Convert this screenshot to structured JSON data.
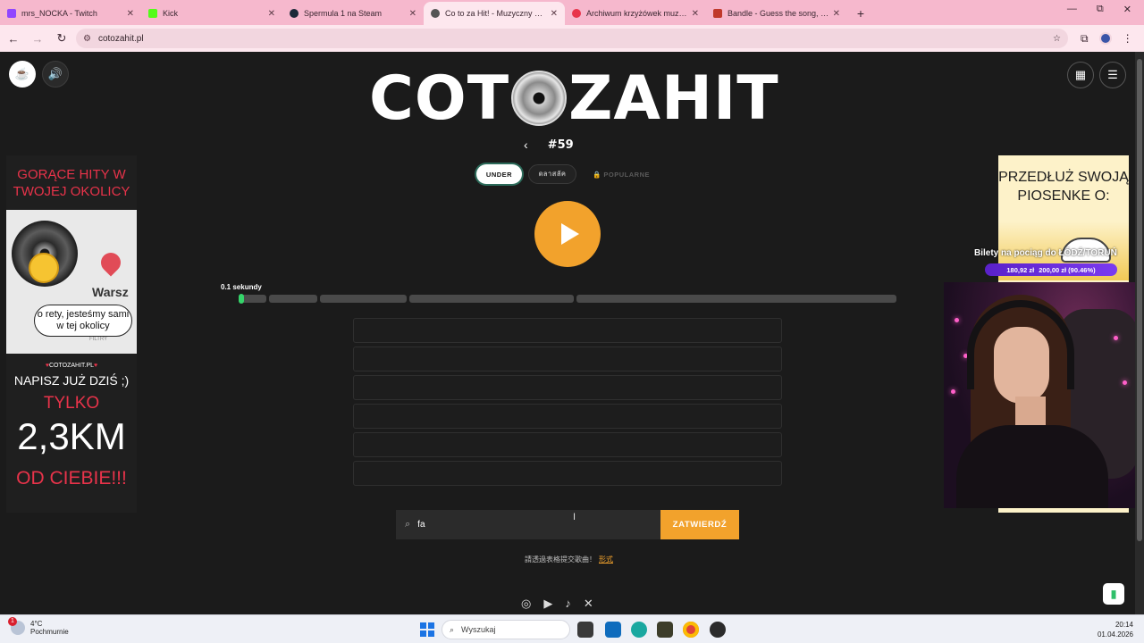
{
  "browser": {
    "tabs": [
      {
        "title": "mrs_NOCKA - Twitch",
        "color": "#9146ff",
        "active": false
      },
      {
        "title": "Kick",
        "color": "#53fc18",
        "active": false
      },
      {
        "title": "Spermula 1 na Steam",
        "color": "#1b2838",
        "active": false
      },
      {
        "title": "Co to za Hit! - Muzyczny Quiz H",
        "color": "#555555",
        "active": true
      },
      {
        "title": "Archiwum krzyżówek muzyczny",
        "color": "#e8334a",
        "active": false
      },
      {
        "title": "Bandle - Guess the song, one in",
        "color": "#c0392b",
        "active": false
      }
    ],
    "tab_close": "✕",
    "new_tab": "+",
    "window_controls": {
      "minimize": "—",
      "restore": "⧉",
      "close": "✕"
    },
    "url": "cotozahit.pl",
    "icons": {
      "back": "back-arrow-icon",
      "forward": "forward-arrow-icon",
      "reload": "reload-icon"
    }
  },
  "page": {
    "logo_left": "COT",
    "logo_right": "ZAHIT",
    "puzzle_number": "#59",
    "prev": "‹",
    "pills": {
      "under": "UNDER",
      "alt": "ดลาสลัค",
      "popular": "🔒 POPULARNE"
    },
    "progress": {
      "label": "0.1 sekundy",
      "filled_fraction": 0.02,
      "segments_count": 6
    },
    "guess_rows": 6,
    "search": {
      "value": "fa",
      "placeholder": ""
    },
    "submit_label": "ZATWIERDŹ",
    "hint_text": "請透過表格提交歌曲！",
    "hint_link": "形式",
    "socials": [
      "instagram-icon",
      "youtube-icon",
      "tiktok-icon",
      "x-icon"
    ],
    "accent_color": "#f2a22c"
  },
  "ad_left": {
    "headline": "GORĄCE HITY W TWOJEJ OKOLICY",
    "map_city": "Warsz",
    "map_filter": "FILTRY",
    "bubble": "o rety, jesteśmy sami w tej okolicy",
    "brand": "COTOZAHIT.PL",
    "write_now": "NAPISZ JUŻ DZIŚ ;)",
    "only": "TYLKO",
    "distance": "2,3KM",
    "from_you": "OD CIEBIE!!!"
  },
  "ad_right": {
    "headline": "PRZEDŁUŻ SWOJĄ PIOSENKE O:"
  },
  "overlay": {
    "ticker": "Bilety na pociąg do ŁÓDŹ/TORUŃ",
    "amount_current": "180,92 zł",
    "amount_goal": "200,00 zł (90.46%)"
  },
  "taskbar": {
    "temperature": "4°C",
    "weather": "Pochmurnie",
    "notification_count": "1",
    "search_placeholder": "Wyszukaj",
    "time": "20:14",
    "date": "01.04.2026"
  }
}
